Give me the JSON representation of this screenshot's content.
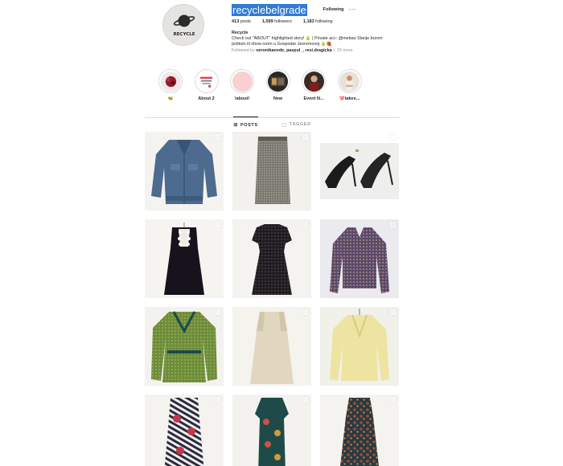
{
  "profile": {
    "username": "recyclebelgrade",
    "follow_button": "Following",
    "more_button": "···",
    "avatar_text": "RECYCLE",
    "stats": [
      {
        "value": "413",
        "label": "posts"
      },
      {
        "value": "1,599",
        "label": "followers"
      },
      {
        "value": "1,183",
        "label": "following"
      }
    ],
    "bio_name": "Recycle",
    "bio_line1": "Check out \"ABOUT\" highlighted story! 🍐 | Private acc: @mebau Slanje brzom",
    "bio_line2": "poštom ili show room u Gospodar Jevremovoj 🍐🍓",
    "followed_by_prefix": "Followed by ",
    "followed_by_names": "veronikaovde, paspul_, resi.dragicka",
    "followed_by_suffix": " + 15 more"
  },
  "highlights": [
    {
      "label": "🐝"
    },
    {
      "label": "About 2"
    },
    {
      "label": "!about!"
    },
    {
      "label": "New"
    },
    {
      "label": "Event N..."
    },
    {
      "label": "💝takes..."
    }
  ],
  "tabs": [
    {
      "icon": "⊞",
      "label": "POSTS"
    },
    {
      "icon": "▢",
      "label": "TAGGED"
    }
  ],
  "colors": {
    "selection_highlight": "#2e7bd6",
    "divider": "#dbdbdb"
  }
}
